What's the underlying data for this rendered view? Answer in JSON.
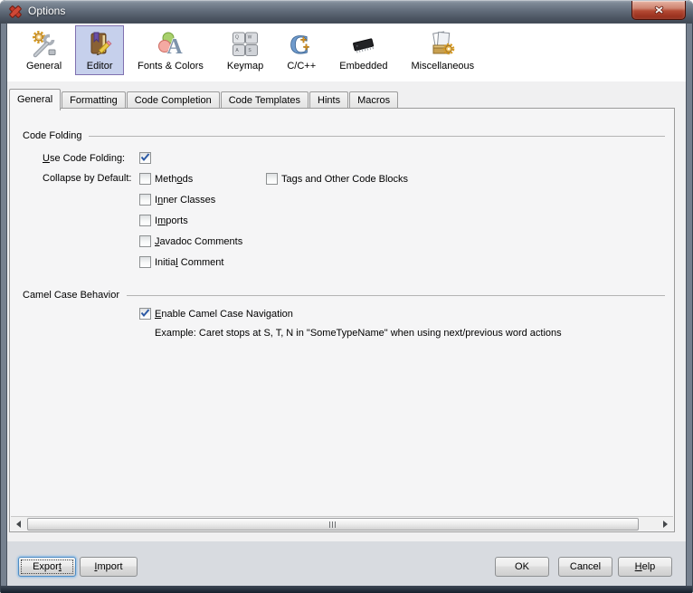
{
  "window": {
    "title": "Options"
  },
  "toolbar": {
    "items": [
      {
        "label": "General",
        "selected": false
      },
      {
        "label": "Editor",
        "selected": true
      },
      {
        "label": "Fonts & Colors",
        "selected": false
      },
      {
        "label": "Keymap",
        "selected": false
      },
      {
        "label": "C/C++",
        "selected": false
      },
      {
        "label": "Embedded",
        "selected": false
      },
      {
        "label": "Miscellaneous",
        "selected": false
      }
    ]
  },
  "tabs": [
    {
      "label": "General",
      "selected": true
    },
    {
      "label": "Formatting",
      "selected": false
    },
    {
      "label": "Code Completion",
      "selected": false
    },
    {
      "label": "Code Templates",
      "selected": false
    },
    {
      "label": "Hints",
      "selected": false
    },
    {
      "label": "Macros",
      "selected": false
    }
  ],
  "content": {
    "code_folding": {
      "title": "Code Folding",
      "use_code_folding": {
        "text": "Use Code Folding:",
        "u": 0,
        "checked": true
      },
      "collapse_by_default": {
        "text": "Collapse by Default:",
        "u": -1
      },
      "column1": [
        {
          "text": "Methods",
          "u": 4,
          "checked": false
        },
        {
          "text": "Inner Classes",
          "u": 1,
          "checked": false
        },
        {
          "text": "Imports",
          "u": 1,
          "checked": false
        },
        {
          "text": "Javadoc Comments",
          "u": 0,
          "checked": false
        },
        {
          "text": "Initial Comment",
          "u": 6,
          "checked": false
        }
      ],
      "column2": [
        {
          "text": "Tags and Other Code Blocks",
          "u": 2,
          "checked": false
        }
      ]
    },
    "camel_case": {
      "title": "Camel Case Behavior",
      "enable_navigation": {
        "text": "Enable Camel Case Navigation",
        "u": 0,
        "checked": true
      },
      "example": "Example: Caret stops at S, T, N in \"SomeTypeName\" when using next/previous word actions"
    }
  },
  "footer": {
    "export": {
      "text": "Export",
      "u": 5
    },
    "import": {
      "text": "Import",
      "u": 0
    },
    "ok": {
      "text": "OK",
      "u": -1
    },
    "cancel": {
      "text": "Cancel",
      "u": -1
    },
    "help": {
      "text": "Help",
      "u": 0
    }
  },
  "colors": {
    "titlebar_dark": "#3e4751",
    "toolbar_selected_bg": "#c6d0ec",
    "toolbar_selected_border": "#8070b0",
    "close_button_red": "#b44a34",
    "checkmark_blue": "#2b59a5",
    "focus_ring_blue": "#8ebde6"
  }
}
